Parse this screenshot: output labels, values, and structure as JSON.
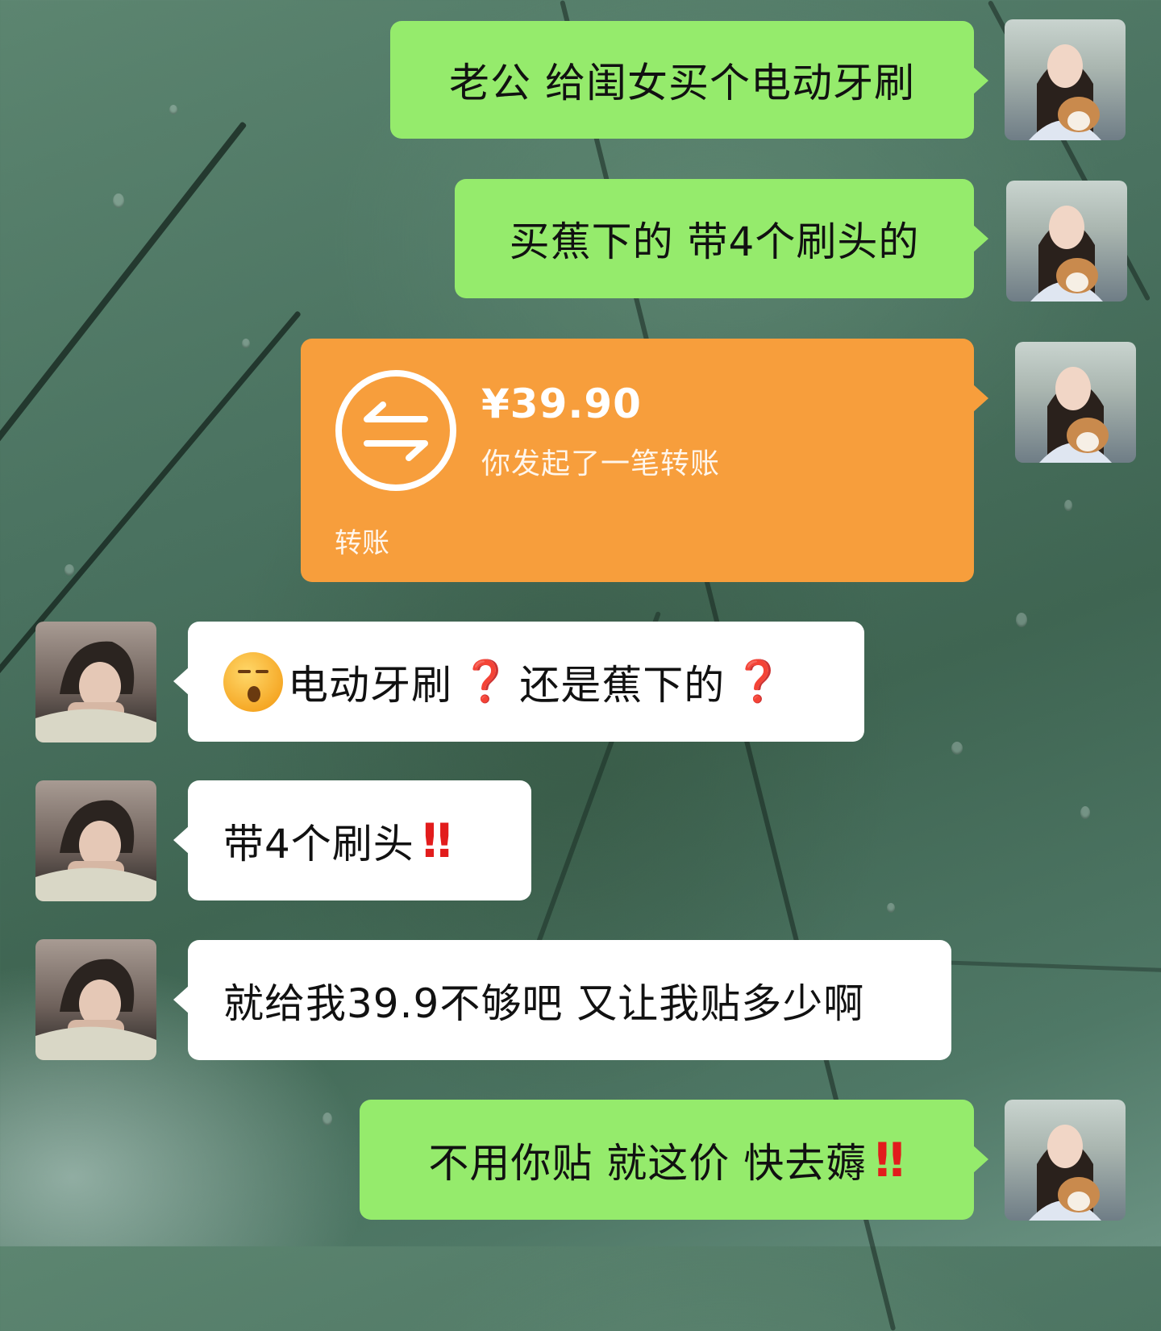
{
  "chat": {
    "messages": [
      {
        "side": "right",
        "type": "text",
        "text": "老公 给闺女买个电动牙刷"
      },
      {
        "side": "right",
        "type": "text",
        "text": "买蕉下的 带4个刷头的"
      },
      {
        "side": "right",
        "type": "transfer",
        "amount": "¥39.90",
        "status": "你发起了一笔转账",
        "footer": "转账"
      },
      {
        "side": "left",
        "type": "text",
        "emoji": "sleepy-face",
        "text_a": "电动牙刷",
        "text_b": "还是蕉下的",
        "mark": "❓"
      },
      {
        "side": "left",
        "type": "text",
        "text": "带4个刷头",
        "mark": "‼"
      },
      {
        "side": "left",
        "type": "text",
        "text": "就给我39.9不够吧 又让我贴多少啊"
      },
      {
        "side": "right",
        "type": "text",
        "text": "不用你贴 就这价 快去薅",
        "mark": "‼"
      }
    ]
  },
  "colors": {
    "sent_bubble": "#95eb6c",
    "received_bubble": "#ffffff",
    "transfer_bubble": "#f79e3c",
    "alert_red": "#e21c1c"
  },
  "icons": {
    "transfer": "transfer-arrows-icon"
  }
}
